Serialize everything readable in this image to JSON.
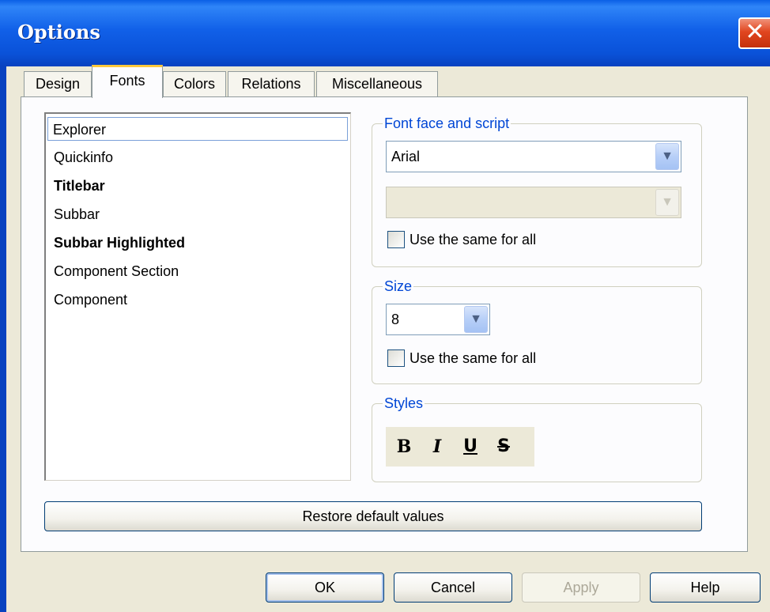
{
  "window": {
    "title": "Options",
    "close_glyph": "✕"
  },
  "tabs": [
    {
      "label": "Design"
    },
    {
      "label": "Fonts"
    },
    {
      "label": "Colors"
    },
    {
      "label": "Relations"
    },
    {
      "label": "Miscellaneous"
    }
  ],
  "active_tab": "Fonts",
  "element_list": {
    "items": [
      {
        "label": "Explorer",
        "bold": false,
        "focused": true
      },
      {
        "label": "Quickinfo",
        "bold": false
      },
      {
        "label": "Titlebar",
        "bold": true
      },
      {
        "label": "Subbar",
        "bold": false
      },
      {
        "label": "Subbar Highlighted",
        "bold": true
      },
      {
        "label": "Component Section",
        "bold": false
      },
      {
        "label": "Component",
        "bold": false
      }
    ]
  },
  "font_face_group": {
    "label": "Font face and script",
    "font_value": "Arial",
    "script_value": "",
    "same_for_all_label": "Use the same for all",
    "same_for_all_checked": false
  },
  "size_group": {
    "label": "Size",
    "size_value": "8",
    "same_for_all_label": "Use the same for all",
    "same_for_all_checked": false
  },
  "styles_group": {
    "label": "Styles",
    "bold_glyph": "B",
    "italic_glyph": "I",
    "underline_glyph": "U",
    "strike_glyph": "S"
  },
  "restore_button": "Restore default values",
  "dialog_buttons": {
    "ok": "OK",
    "cancel": "Cancel",
    "apply": "Apply",
    "help": "Help"
  },
  "colors": {
    "group_label": "#0046d5",
    "titlebar": "#0a52d9",
    "active_tab_accent": "#ffc83c"
  }
}
